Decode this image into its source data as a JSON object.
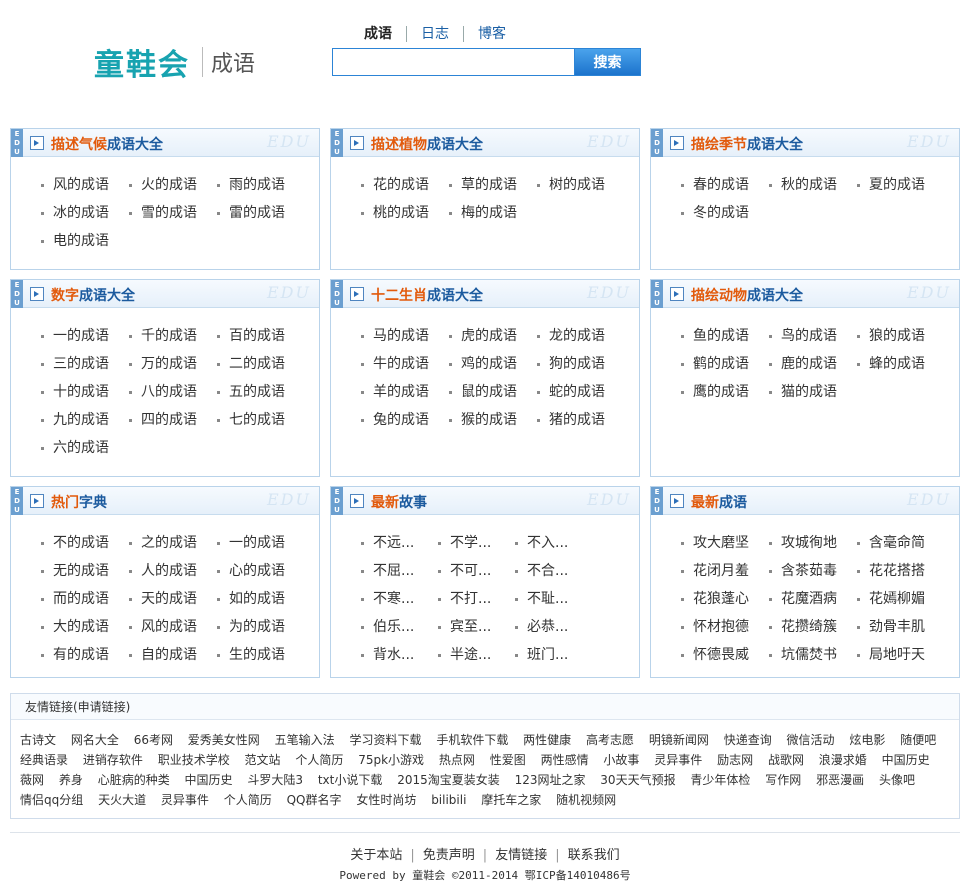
{
  "header": {
    "logo_main": "童鞋会",
    "logo_sub": "成语",
    "tabs": [
      "成语",
      "日志",
      "博客"
    ],
    "search_button": "搜索",
    "search_value": ""
  },
  "box_badge": "EDU",
  "box_watermark": "EDU",
  "boxes": [
    {
      "title_hl": "描述气候",
      "title_rest": "成语大全",
      "items": [
        "风的成语",
        "火的成语",
        "雨的成语",
        "冰的成语",
        "雪的成语",
        "雷的成语",
        "电的成语"
      ]
    },
    {
      "title_hl": "描述植物",
      "title_rest": "成语大全",
      "items": [
        "花的成语",
        "草的成语",
        "树的成语",
        "桃的成语",
        "梅的成语"
      ]
    },
    {
      "title_hl": "描绘季节",
      "title_rest": "成语大全",
      "items": [
        "春的成语",
        "秋的成语",
        "夏的成语",
        "冬的成语"
      ]
    },
    {
      "title_hl": "数字",
      "title_rest": "成语大全",
      "items": [
        "一的成语",
        "千的成语",
        "百的成语",
        "三的成语",
        "万的成语",
        "二的成语",
        "十的成语",
        "八的成语",
        "五的成语",
        "九的成语",
        "四的成语",
        "七的成语",
        "六的成语"
      ]
    },
    {
      "title_hl": "十二生肖",
      "title_rest": "成语大全",
      "items": [
        "马的成语",
        "虎的成语",
        "龙的成语",
        "牛的成语",
        "鸡的成语",
        "狗的成语",
        "羊的成语",
        "鼠的成语",
        "蛇的成语",
        "兔的成语",
        "猴的成语",
        "猪的成语"
      ]
    },
    {
      "title_hl": "描绘动物",
      "title_rest": "成语大全",
      "items": [
        "鱼的成语",
        "鸟的成语",
        "狼的成语",
        "鹤的成语",
        "鹿的成语",
        "蜂的成语",
        "鹰的成语",
        "猫的成语"
      ]
    },
    {
      "title_hl": "热门",
      "title_rest": "字典",
      "items": [
        "不的成语",
        "之的成语",
        "一的成语",
        "无的成语",
        "人的成语",
        "心的成语",
        "而的成语",
        "天的成语",
        "如的成语",
        "大的成语",
        "风的成语",
        "为的成语",
        "有的成语",
        "自的成语",
        "生的成语"
      ]
    },
    {
      "title_hl": "最新",
      "title_rest": "故事",
      "items": [
        "不远...",
        "不学...",
        "不入...",
        "不屈...",
        "不可...",
        "不合...",
        "不寒...",
        "不打...",
        "不耻...",
        "伯乐...",
        "宾至...",
        "必恭...",
        "背水...",
        "半途...",
        "班门..."
      ]
    },
    {
      "title_hl": "最新",
      "title_rest": "成语",
      "items": [
        "攻大磨坚",
        "攻城徇地",
        "含毫命简",
        "花闭月羞",
        "含茶茹毒",
        "花花搭搭",
        "花狼蓬心",
        "花魔酒病",
        "花嫣柳媚",
        "怀材抱德",
        "花攒绮簇",
        "劲骨丰肌",
        "怀德畏威",
        "坑儒焚书",
        "局地吁天"
      ]
    }
  ],
  "links": {
    "heading": "友情链接(申请链接)",
    "items": [
      "古诗文",
      "网名大全",
      "66考网",
      "爱秀美女性网",
      "五笔输入法",
      "学习资料下载",
      "手机软件下载",
      "两性健康",
      "高考志愿",
      "明镜新闻网",
      "快递查询",
      "微信活动",
      "炫电影",
      "随便吧",
      "经典语录",
      "进销存软件",
      "职业技术学校",
      "范文站",
      "个人简历",
      "75pk小游戏",
      "热点网",
      "性爱图",
      "两性感情",
      "小故事",
      "灵异事件",
      "励志网",
      "战歌网",
      "浪漫求婚",
      "中国历史",
      "薇网",
      "养身",
      "心脏病的种类",
      "中国历史",
      "斗罗大陆3",
      "txt小说下载",
      "2015淘宝夏装女装",
      "123网址之家",
      "30天天气预报",
      "青少年体检",
      "写作网",
      "邪恶漫画",
      "头像吧",
      "情侣qq分组",
      "天火大道",
      "灵异事件",
      "个人简历",
      "QQ群名字",
      "女性时尚坊",
      "bilibili",
      "摩托车之家",
      "随机视频网"
    ]
  },
  "footer": {
    "nav": [
      "关于本站",
      "免责声明",
      "友情链接",
      "联系我们"
    ],
    "separator": "|",
    "copyright": "Powered by 童鞋会 ©2011-2014 鄂ICP备14010486号"
  }
}
